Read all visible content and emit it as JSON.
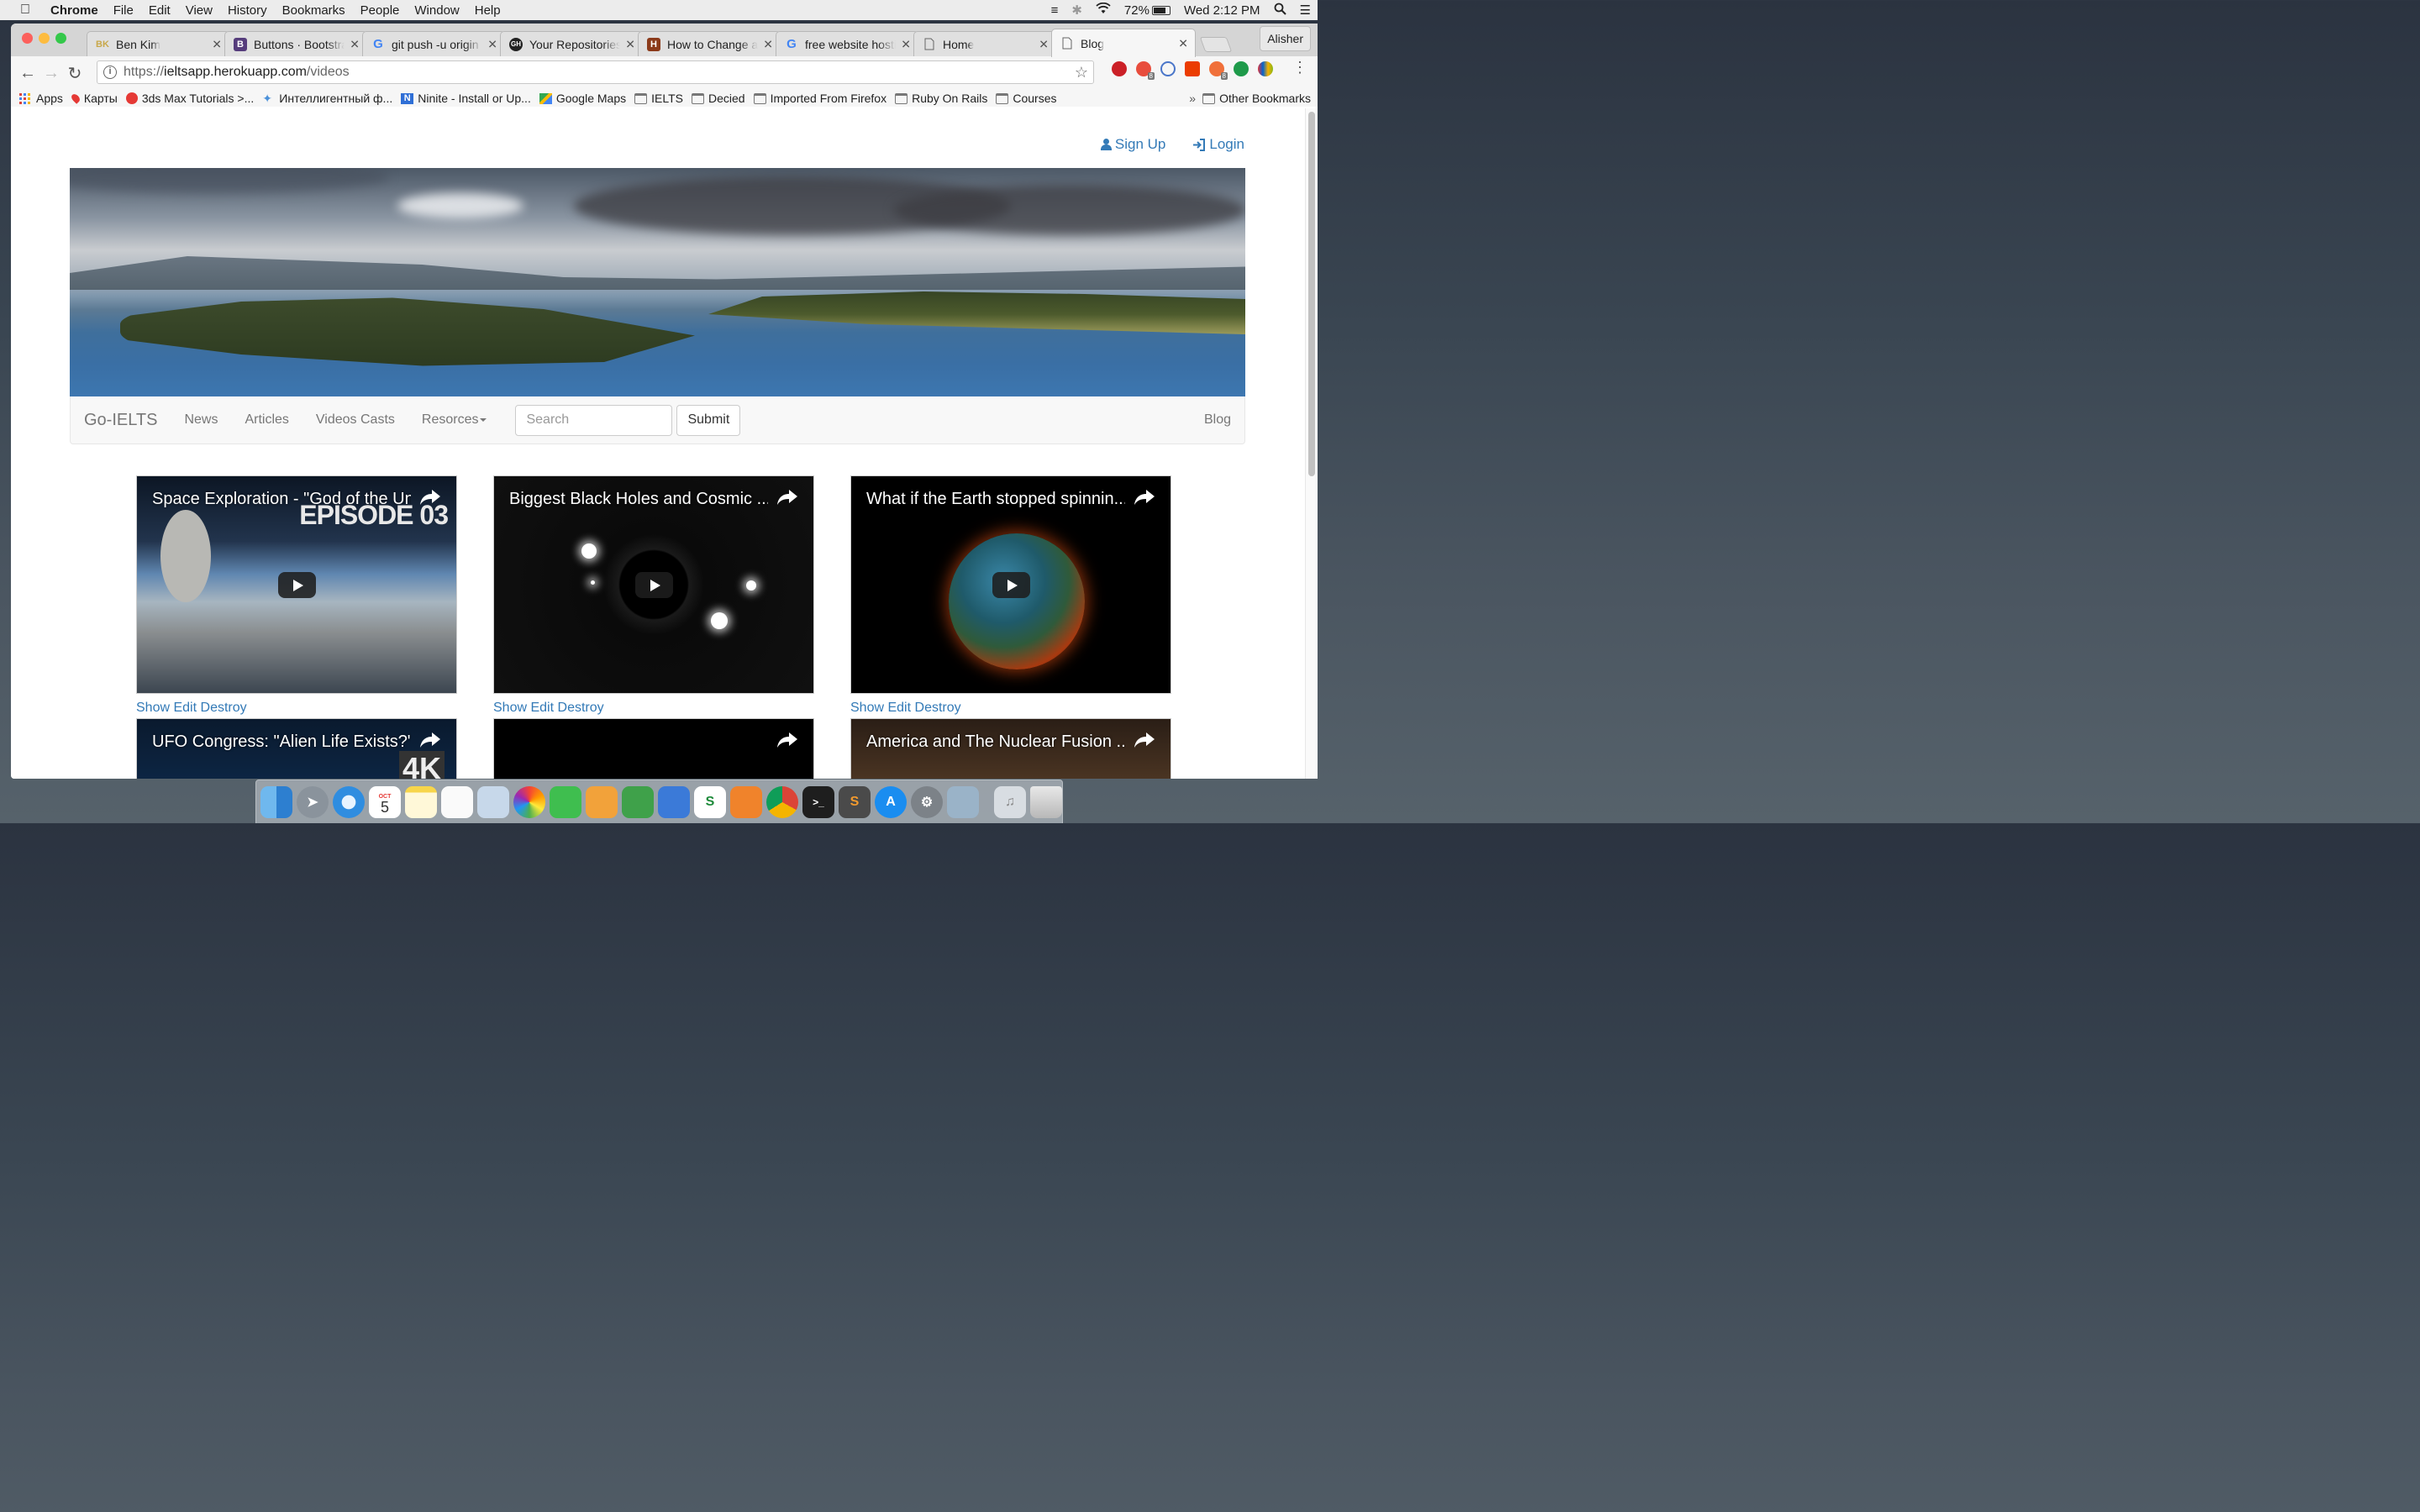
{
  "menubar": {
    "app_name": "Chrome",
    "items": [
      "File",
      "Edit",
      "View",
      "History",
      "Bookmarks",
      "People",
      "Window",
      "Help"
    ],
    "battery": "72%",
    "clock": "Wed 2:12 PM"
  },
  "tabs": [
    {
      "title": "Ben Kim",
      "favicon": "BK",
      "color": "#c8a84a"
    },
    {
      "title": "Buttons · Bootstrap",
      "favicon": "B",
      "color": "#563d7c"
    },
    {
      "title": "git push -u origin m",
      "favicon": "G",
      "color": "#4285f4"
    },
    {
      "title": "Your Repositories",
      "favicon": "GH",
      "color": "#222222"
    },
    {
      "title": "How to Change a",
      "favicon": "H",
      "color": "#8b3a1a"
    },
    {
      "title": "free website hostin",
      "favicon": "G",
      "color": "#4285f4"
    },
    {
      "title": "Home",
      "favicon": "doc",
      "color": "#666666"
    },
    {
      "title": "Blog",
      "favicon": "doc",
      "color": "#666666"
    }
  ],
  "profile_name": "Alisher",
  "address": {
    "scheme": "https://",
    "host": "ieltsapp.herokuapp.com",
    "path": "/videos"
  },
  "bookmarks": {
    "items": [
      {
        "label": "Apps",
        "icon": "apps-grid-icon"
      },
      {
        "label": "Карты",
        "icon": "map-pin-icon"
      },
      {
        "label": "3ds Max Tutorials >...",
        "icon": "tutorials-icon"
      },
      {
        "label": "Интеллигентный ф...",
        "icon": "bird-icon"
      },
      {
        "label": "Ninite - Install or Up...",
        "icon": "ninite-icon"
      },
      {
        "label": "Google Maps",
        "icon": "google-maps-icon"
      },
      {
        "label": "IELTS",
        "icon": "folder-icon"
      },
      {
        "label": "Decied",
        "icon": "folder-icon"
      },
      {
        "label": "Imported From Firefox",
        "icon": "folder-icon"
      },
      {
        "label": "Ruby On Rails",
        "icon": "folder-icon"
      },
      {
        "label": "Courses",
        "icon": "folder-icon"
      }
    ],
    "overflow": "»",
    "other": "Other Bookmarks"
  },
  "page": {
    "auth": {
      "signup": "Sign Up",
      "login": "Login"
    },
    "navbar": {
      "brand": "Go-IELTS",
      "links": [
        "News",
        "Articles",
        "Videos Casts"
      ],
      "dropdown": "Resorces",
      "search_placeholder": "Search",
      "submit": "Submit",
      "right_link": "Blog"
    },
    "videos": [
      {
        "title": "Space Exploration - \"God of the Un...",
        "overlay": "EPISODE 03"
      },
      {
        "title": "Biggest Black Holes and Cosmic ...",
        "overlay": ""
      },
      {
        "title": "What if the Earth stopped spinnin...",
        "overlay": ""
      },
      {
        "title": "UFO Congress: \"Alien Life Exists?\" ...",
        "overlay": "4K"
      },
      {
        "title": "",
        "overlay": ""
      },
      {
        "title": "America and The Nuclear Fusion ...",
        "overlay": ""
      }
    ],
    "actions": {
      "show": "Show",
      "edit": "Edit",
      "destroy": "Destroy"
    }
  },
  "dock": {
    "apps": [
      "finder",
      "launchpad",
      "safari",
      "calendar",
      "notes",
      "reminders",
      "preview",
      "photos",
      "facetime",
      "pages",
      "numbers",
      "keynote",
      "sketchbook",
      "ibooks",
      "chrome",
      "terminal",
      "sublime-text",
      "app-store",
      "system-preferences",
      "image-capture",
      "music-folder",
      "trash"
    ],
    "calendar_month": "OCT",
    "calendar_day": "5"
  }
}
